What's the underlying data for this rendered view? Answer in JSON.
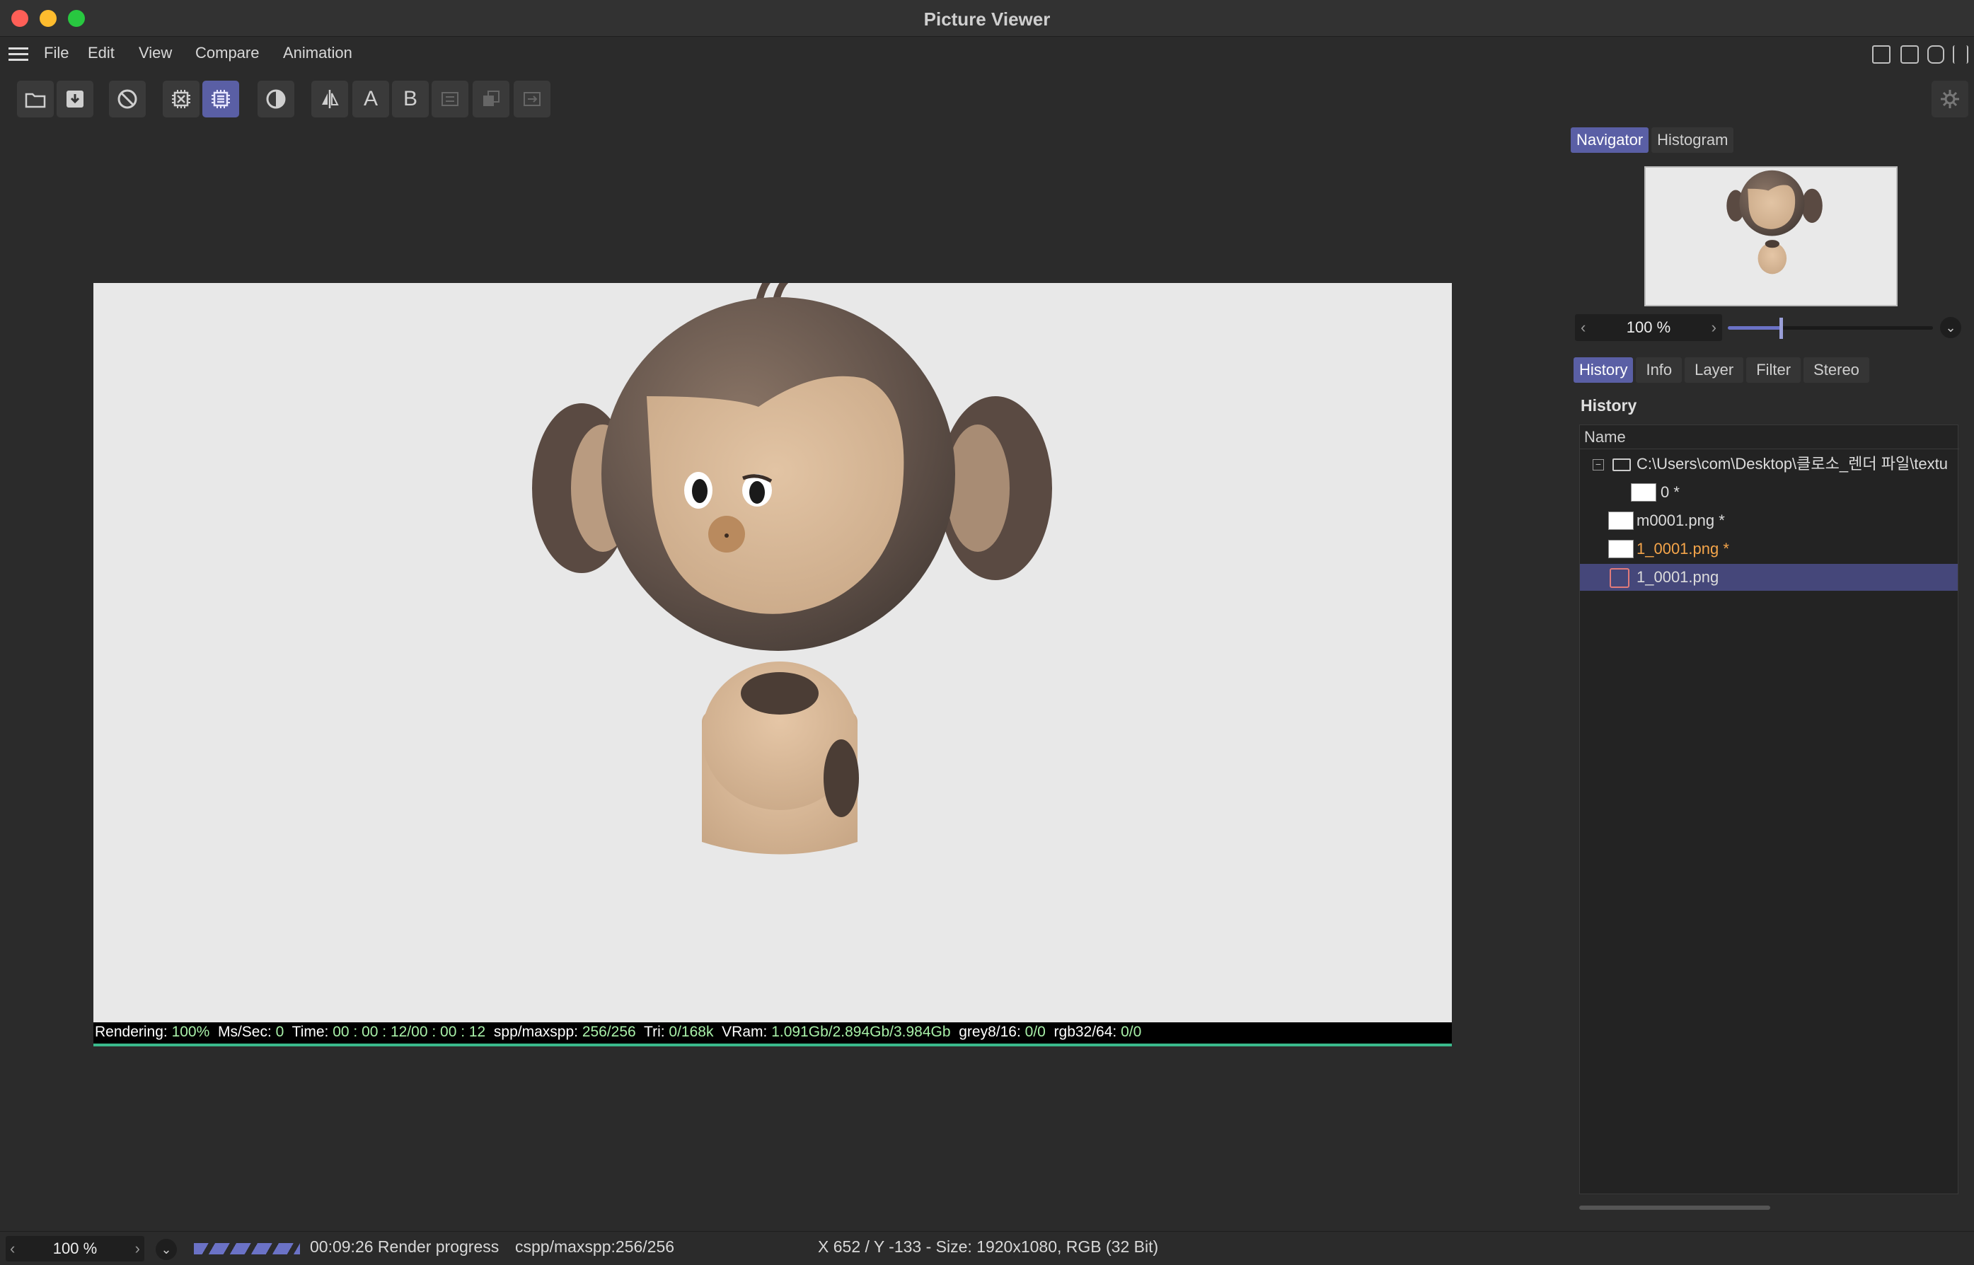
{
  "window": {
    "title": "Picture Viewer"
  },
  "menu": [
    "File",
    "Edit",
    "View",
    "Compare",
    "Animation"
  ],
  "toolbar": {
    "compare_a": "A",
    "compare_b": "B"
  },
  "status_line": {
    "rendering_label": "Rendering:",
    "rendering_value": "100%",
    "mssec_label": "Ms/Sec:",
    "mssec_value": "0",
    "time_label": "Time:",
    "time_value": "00 : 00 : 12/00 : 00 : 12",
    "spp_label": "spp/maxspp:",
    "spp_value": "256/256",
    "tri_label": "Tri:",
    "tri_value": "0/168k",
    "vram_label": "VRam:",
    "vram_value": "1.091Gb/2.894Gb/3.984Gb",
    "grey_label": "grey8/16:",
    "grey_value": "0/0",
    "rgb_label": "rgb32/64:",
    "rgb_value": "0/0",
    "progress": 1.0
  },
  "panel_tabs_top": [
    "Navigator",
    "Histogram"
  ],
  "zoom": {
    "value": "100 %",
    "slider": 0.26
  },
  "panel_tabs": [
    "History",
    "Info",
    "Layer",
    "Filter",
    "Stereo"
  ],
  "history": {
    "title": "History",
    "column": "Name",
    "rows": [
      {
        "label": "C:\\Users\\com\\Desktop\\클로소_렌더 파일\\textu"
      },
      {
        "label": "0 *"
      },
      {
        "label": "m0001.png *"
      },
      {
        "label": "1_0001.png *"
      },
      {
        "label": "1_0001.png"
      }
    ]
  },
  "bottom": {
    "zoom": "100 %",
    "render_time": "00:09:26 Render progress",
    "cspp": "cspp/maxspp:256/256",
    "info": "X 652 / Y -133 - Size: 1920x1080, RGB (32 Bit)"
  }
}
